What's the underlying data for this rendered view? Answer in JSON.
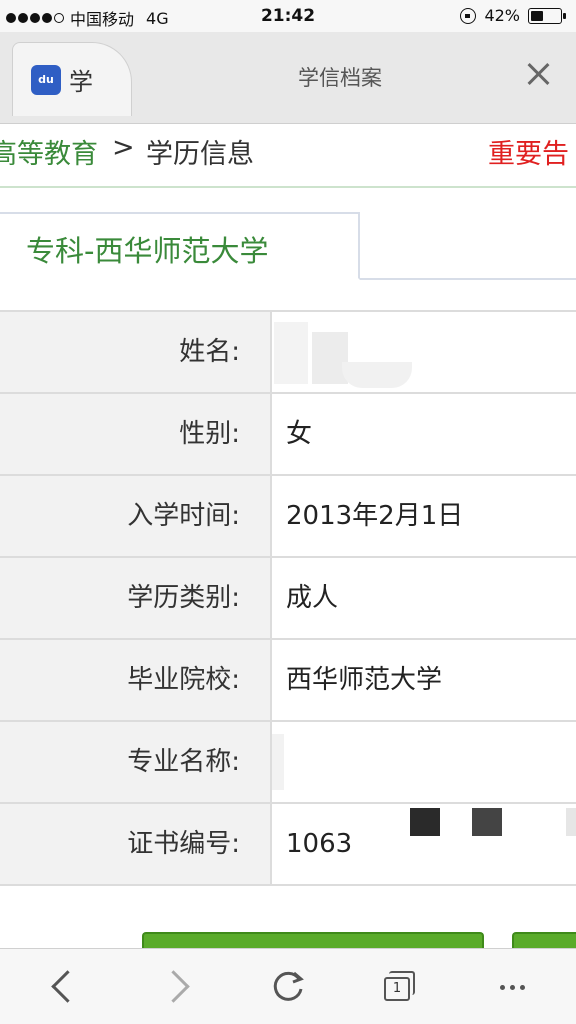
{
  "status_bar": {
    "carrier": "中国移动",
    "network": "4G",
    "time": "21:42",
    "battery": "42%",
    "battery_level": 0.42
  },
  "tab_bar": {
    "small_tab_label": "学",
    "small_tab_icon": "baidu-paw-icon",
    "title": "学信档案"
  },
  "breadcrumb": {
    "parent": "高等教育",
    "separator": ">",
    "current": "学历信息",
    "notice": "重要告"
  },
  "section_tab": {
    "label": "专科-西华师范大学"
  },
  "info_rows": [
    {
      "label": "姓名:",
      "value": ""
    },
    {
      "label": "性别:",
      "value": "女"
    },
    {
      "label": "入学时间:",
      "value": "2013年2月1日"
    },
    {
      "label": "学历类别:",
      "value": "成人"
    },
    {
      "label": "毕业院校:",
      "value": "西华师范大学"
    },
    {
      "label": "专业名称:",
      "value": ""
    },
    {
      "label": "证书编号:",
      "value": "1063"
    }
  ],
  "toolbar": {
    "tabs_count": "1"
  },
  "colors": {
    "link_green": "#3a8a3a",
    "notice_red": "#e02020",
    "button_green": "#5aab2a"
  }
}
